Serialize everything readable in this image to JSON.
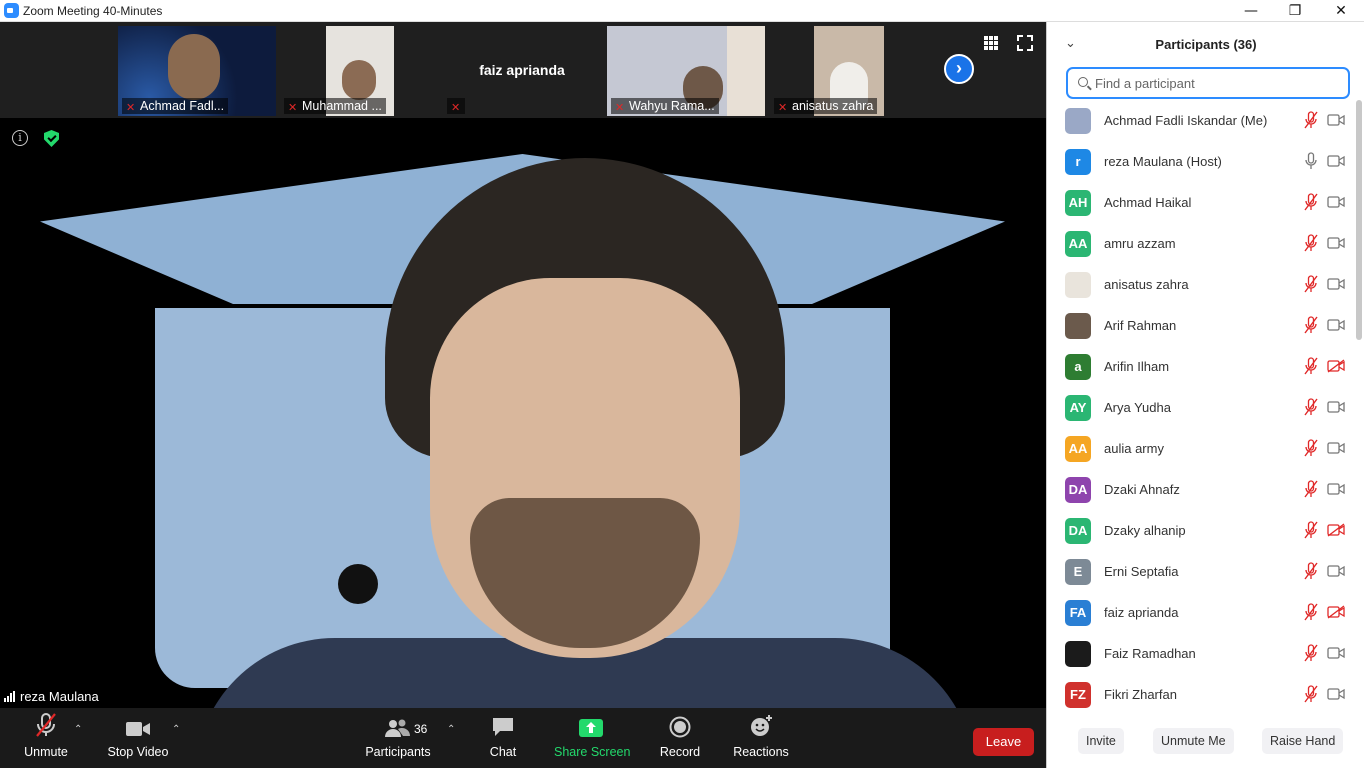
{
  "window": {
    "title": "Zoom Meeting 40-Minutes",
    "minimize": "—",
    "restore": "❐",
    "close": "✕"
  },
  "thumbnails": [
    {
      "name": "Achmad Fadl...",
      "muted": true,
      "video": true,
      "bg": "#0d1b3d"
    },
    {
      "name": "Muhammad ...",
      "muted": true,
      "video": true,
      "bg": "#e6e3de"
    },
    {
      "name": "faiz aprianda",
      "muted": true,
      "video": false,
      "bg": "#1f1f1f"
    },
    {
      "name": "Wahyu Rama...",
      "muted": true,
      "video": true,
      "bg": "#c5c8d3"
    },
    {
      "name": "anisatus zahra",
      "muted": true,
      "video": true,
      "bg": "#c9b9a8"
    }
  ],
  "view_controls": {
    "grid_icon": "gallery-view-icon",
    "fullscreen_icon": "fullscreen-icon",
    "next_icon": "chevron-right-icon"
  },
  "speaker": {
    "name": "reza Maulana"
  },
  "toolbar": {
    "unmute": "Unmute",
    "stop_video": "Stop Video",
    "participants": "Participants",
    "participant_count": "36",
    "chat": "Chat",
    "share_screen": "Share Screen",
    "record": "Record",
    "reactions": "Reactions",
    "leave": "Leave",
    "share_color": "#23d96c",
    "leave_color": "#c81e1e"
  },
  "panel": {
    "title": "Participants (36)",
    "search_placeholder": "Find a participant",
    "participants": [
      {
        "name": "Achmad Fadli Iskandar (Me)",
        "initials": "",
        "color": "#9aa8c6",
        "mic": "muted",
        "video": "on"
      },
      {
        "name": "reza Maulana (Host)",
        "initials": "r",
        "color": "#1e88e5",
        "mic": "on",
        "video": "on"
      },
      {
        "name": "Achmad Haikal",
        "initials": "AH",
        "color": "#2bb673",
        "mic": "muted",
        "video": "on"
      },
      {
        "name": "amru azzam",
        "initials": "AA",
        "color": "#2bb673",
        "mic": "muted",
        "video": "on"
      },
      {
        "name": "anisatus zahra",
        "initials": "",
        "color": "#e9e4dc",
        "mic": "muted",
        "video": "on"
      },
      {
        "name": "Arif Rahman",
        "initials": "",
        "color": "#6b5a4c",
        "mic": "muted",
        "video": "on"
      },
      {
        "name": "Arifin Ilham",
        "initials": "a",
        "color": "#2e7d32",
        "mic": "muted",
        "video": "off"
      },
      {
        "name": "Arya Yudha",
        "initials": "AY",
        "color": "#2bb673",
        "mic": "muted",
        "video": "on"
      },
      {
        "name": "aulia army",
        "initials": "AA",
        "color": "#f5a623",
        "mic": "muted",
        "video": "on"
      },
      {
        "name": "Dzaki Ahnafz",
        "initials": "DA",
        "color": "#8e44ad",
        "mic": "muted",
        "video": "on"
      },
      {
        "name": "Dzaky alhanip",
        "initials": "DA",
        "color": "#2bb673",
        "mic": "muted",
        "video": "off"
      },
      {
        "name": "Erni Septafia",
        "initials": "E",
        "color": "#7d8a96",
        "mic": "muted",
        "video": "on"
      },
      {
        "name": "faiz aprianda",
        "initials": "FA",
        "color": "#2a7fd4",
        "mic": "muted",
        "video": "off"
      },
      {
        "name": "Faiz Ramadhan",
        "initials": "",
        "color": "#1b1b1b",
        "mic": "muted",
        "video": "on"
      },
      {
        "name": "Fikri Zharfan",
        "initials": "FZ",
        "color": "#d0312d",
        "mic": "muted",
        "video": "on"
      }
    ],
    "invite": "Invite",
    "unmute_me": "Unmute Me",
    "raise_hand": "Raise Hand"
  }
}
